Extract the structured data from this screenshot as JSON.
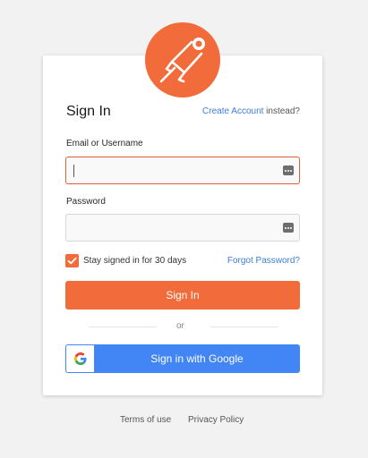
{
  "header": {
    "title": "Sign In"
  },
  "create_account": {
    "link": "Create Account",
    "suffix": " instead?"
  },
  "email": {
    "label": "Email or Username",
    "value": "",
    "placeholder": ""
  },
  "password": {
    "label": "Password",
    "value": "",
    "placeholder": ""
  },
  "remember": {
    "label": "Stay signed in for 30 days",
    "checked": true
  },
  "forgot": {
    "label": "Forgot Password?"
  },
  "signin_button": {
    "label": "Sign In"
  },
  "divider": {
    "label": "or"
  },
  "google_button": {
    "label": "Sign in with Google"
  },
  "footer": {
    "terms": "Terms of use",
    "privacy": "Privacy Policy"
  },
  "colors": {
    "brand": "#f26b3a",
    "link": "#3d7ed9",
    "google": "#4285f4"
  },
  "icons": {
    "logo": "postman-astronaut-logo",
    "field_menu": "keyboard-icon",
    "google": "google-g-icon"
  }
}
